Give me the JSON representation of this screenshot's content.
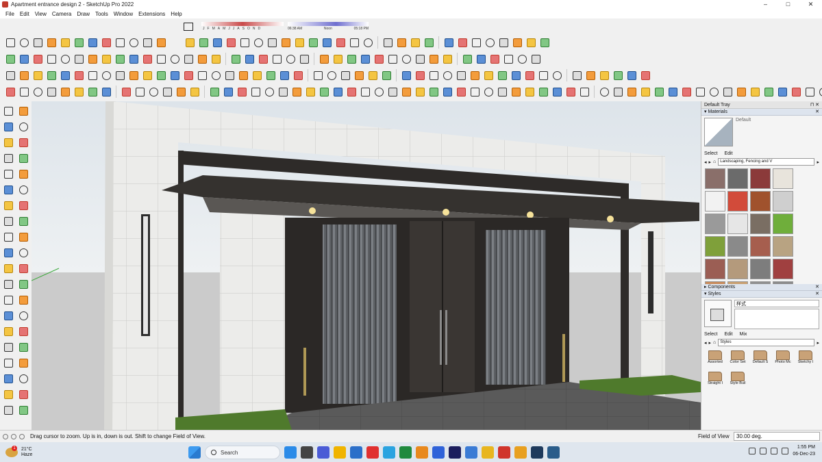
{
  "window": {
    "title": "Apartment entrance design 2 - SketchUp Pro 2022",
    "controls": {
      "minimize": "–",
      "maximize": "□",
      "close": "✕"
    }
  },
  "menu": [
    "File",
    "Edit",
    "View",
    "Camera",
    "Draw",
    "Tools",
    "Window",
    "Extensions",
    "Help"
  ],
  "shadow_settings": {
    "months": [
      "J",
      "F",
      "M",
      "A",
      "M",
      "J",
      "J",
      "A",
      "S",
      "O",
      "N",
      "D"
    ],
    "sunrise": "06:38 AM",
    "noon": "Noon",
    "sunset": "05:18 PM"
  },
  "tray": {
    "title": "Default Tray",
    "materials": {
      "header": "Materials",
      "current": "Default",
      "tabs": [
        "Select",
        "Edit"
      ],
      "library": "Landscaping, Fencing and V",
      "swatch_colors": [
        "#8a6f6a",
        "#6b6b6b",
        "#8b3a3a",
        "#e8e4dc",
        "#f2f2f2",
        "#d24b3a",
        "#a0522d",
        "#cfcfcf",
        "#9a9a9a",
        "#e6e6e6",
        "#7a6e63",
        "#6fae3b",
        "#7fa03a",
        "#8a8a8a",
        "#a65e4e",
        "#b8a382",
        "#9b5e54",
        "#b49a7c",
        "#7d7d7d",
        "#a04040",
        "#c98b5a",
        "#c9a070",
        "#8f8f8f",
        "#8a8a8a"
      ]
    },
    "components": {
      "header": "Components"
    },
    "styles": {
      "header": "Styles",
      "name": "样式",
      "tabs": [
        "Select",
        "Edit",
        "Mix"
      ],
      "library": "Styles",
      "folders": [
        "Assorted",
        "Color Set",
        "Default S",
        "Photo Mc",
        "Sketchy I",
        "Straight I",
        "Style Buil"
      ]
    }
  },
  "status": {
    "message": "Drag cursor to zoom.  Up is in, down is out. Shift to change Field of View.",
    "vcb_label": "Field of View",
    "vcb_value": "30.00 deg."
  },
  "taskbar": {
    "weather": {
      "temp": "21°C",
      "condition": "Haze",
      "badge": "1"
    },
    "search_placeholder": "Search",
    "time": "1:55 PM",
    "date": "06-Dec-23",
    "app_colors": [
      "#2b8be8",
      "#444",
      "#4a5bd6",
      "#f0b400",
      "#2b6fc9",
      "#e03030",
      "#2aa3e0",
      "#1f8a3e",
      "#e8891e",
      "#2e62d9",
      "#1b1e5e",
      "#3a7bd5",
      "#e8b620",
      "#d0342c",
      "#e8a020",
      "#1e3a5c",
      "#2a5c8a"
    ]
  },
  "colors": {
    "brand_red": "#c0392b",
    "sky": "#dbe3ea",
    "ground": "#c8c8c8",
    "dark_metal": "#2f2c2a",
    "wall_tile": "#e8e8e4",
    "grass": "#4f7a2c"
  }
}
